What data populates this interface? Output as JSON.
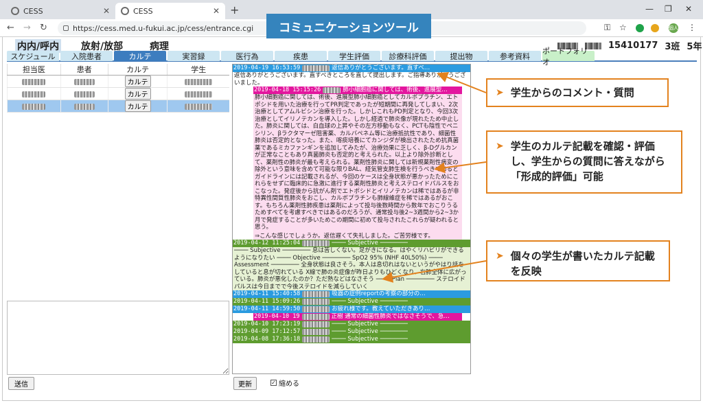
{
  "browser": {
    "tabs": [
      {
        "title": "CESS",
        "active": false
      },
      {
        "title": "CESS",
        "active": true
      }
    ],
    "url": "https://cess.med.u-fukui.ac.jp/cess/entrance.cgi",
    "profile_badge": "個人"
  },
  "banner": "コミュニケーションツール",
  "header": {
    "ward": "内内/呼内",
    "dept": "放射/放部",
    "subdept": "病理",
    "student_id": "15410177",
    "group": "3班",
    "year": "5年"
  },
  "menu": [
    "スケジュール",
    "入院患者",
    "カルテ",
    "実習録",
    "医行為",
    "疾患",
    "学生評価",
    "診療科評価",
    "提出物",
    "参考資料",
    "ポートフォリオ"
  ],
  "menu_active": "カルテ",
  "student_table": {
    "columns": [
      "担当医",
      "患者",
      "カルテ",
      "学生"
    ],
    "rows": [
      {
        "button": "カルテ",
        "selected": false
      },
      {
        "button": "カルテ",
        "selected": false
      },
      {
        "button": "カルテ",
        "selected": true
      }
    ]
  },
  "buttons": {
    "send": "送信",
    "refresh": "更新",
    "collapse": "縮める"
  },
  "log": {
    "entries": [
      {
        "ts": "2019-04-19 16:53:59",
        "color": "blue",
        "msg": "返信ありがとうございます。直すべ…"
      },
      {
        "body_white": "返信ありがとうございます。直すべきところを直して提出します。ご指導ありがとうございました。"
      },
      {
        "ts": "2019-04-18 15:15:26",
        "color": "pink",
        "msg": "肺小細胞癌に関しては、術後、進展型…"
      },
      {
        "body_pink": "肺小細胞癌に関しては、術後、進展型肺小細胞癌としてカルボプラチン、エトポシドを用いた治療を行ってPR判定であったが短期間に再発してしまい、2次治療としてアムルビシン治療を行った。しかしこれもPD判定となり、今回3次治療としてイリノテカンを導入した。しかし経過で肺炎像が現れたため中止した。肺炎に関しては、白血球の上昇やその左方移動もなく、PCTも陰性でペニシリン、βラクタマーゼ阻害薬、カルバペネム等に治療抵抗性であり、細菌性肺炎は否定的となった。また、喀痰培養にてカンジダが検出されたため抗真菌薬であるミカファンギンを追加してみたが、治療効果に乏しく、β-Dグルカンが正常なこともあり真菌肺炎も否定的と考えられた。以上より除外診断として、薬剤性の肺炎が最も考えられる。薬剤性肺炎に関しては新規薬剤性病変の除外という意味を含めて可能な限りBAL、経気管支肺生検を行うべきであるとガイドラインには記載されるが、今回のケースは全身状態が悪かったためにこれらをせずに臨床的に急激に進行する薬剤性肺炎と考えステロイドパルスをおこなった。発症後から抗がん剤でエトポシドとイリノテカンは稀ではあるが非特異性間質性肺炎をおこし、カルボプラチンも肺線維症を稀ではあるがおこす。もちろん薬剤性肺疾患は薬剤によって投与後数時間から数年でおこりうるためすべてを考慮すべきではあるのだろうが、通常投与後2~3週間から2~3か月で発症することが多いためこの期間に初めて投与されたこれらが疑われると思う。"
      },
      {
        "body_pink": "⇒こんな感じでしょうか。返信遅くて失礼しました。ご苦労様です。"
      },
      {
        "ts": "2019-04-12 11:25:04",
        "color": "green",
        "msg": "──── Subjective ────────"
      },
      {
        "body_green": "──── Subjective ──────── 息は苦しくない。足がきになる。はやくリハビリができるようになりたい ──── Objective ──────── SpO2 95% (NHF 40L50%) ──── Assessment ──────── 全身状態は良さそう。本人は息切れはないというがやはり話をしていると息が切れている X線で肺の炎症像が昨日よりもひどくなり、右肺全体に広がっている。肺炎が悪化したのか？ただ熱などはなさそう ──── Plan ──────── ステロイドパルスは今日までで今後ステロイドを減らしていく"
      },
      {
        "ts": "2019-04-11 15:40:58",
        "color": "blue",
        "msg": "吸器の症例reportの考察の部分の…"
      },
      {
        "ts": "2019-04-11 15:09:26",
        "color": "green",
        "msg": "──── Subjective ────────"
      },
      {
        "ts": "2019-04-11 14:59:50",
        "color": "blue",
        "msg": "お疲れ様です。教えていただきあり…"
      },
      {
        "ts": "2019-04-10 19",
        "color": "pink",
        "msg": "正樹 通常の細菌性肺炎ではなさそうで、急…"
      },
      {
        "ts": "2019-04-10 17:23:19",
        "color": "green",
        "msg": "──── Subjective ────────"
      },
      {
        "ts": "2019-04-09 17:12:57",
        "color": "green",
        "msg": "──── Subjective ────────"
      },
      {
        "ts": "2019-04-08 17:36:18",
        "color": "green",
        "msg": "──── Subjective ────────"
      }
    ]
  },
  "callouts": [
    {
      "text": "学生からのコメント・質問"
    },
    {
      "text": "学生のカルテ記載を確認・評価し、学生からの質問に答えながら「形成的評価」可能"
    },
    {
      "text": "個々の学生が書いたカルテ記載を反映"
    }
  ],
  "colors": {
    "banner": "#3584bd",
    "callout_border": "#e3821e",
    "head_blue": "#2b9be0",
    "head_green": "#5e9c2f",
    "head_pink": "#e3169e"
  }
}
